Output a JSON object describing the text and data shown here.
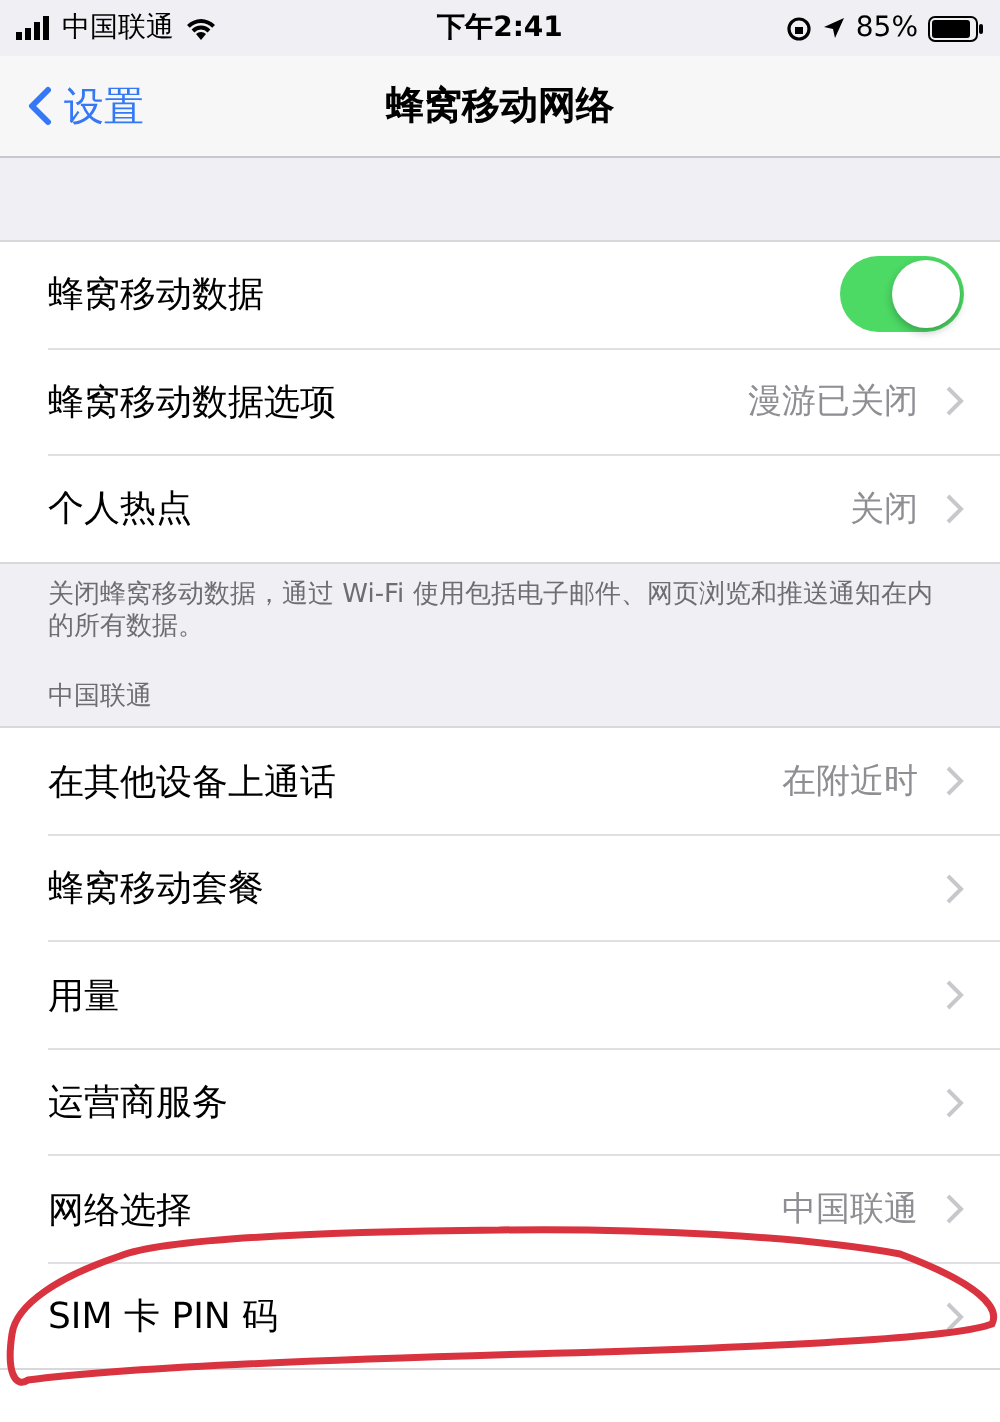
{
  "status_bar": {
    "carrier": "中国联通",
    "time": "下午2:41",
    "battery": "85%"
  },
  "nav": {
    "back": "设置",
    "title": "蜂窝移动网络"
  },
  "sections": [
    {
      "rows": [
        {
          "kind": "toggle",
          "label": "蜂窝移动数据",
          "on": true
        },
        {
          "kind": "link",
          "label": "蜂窝移动数据选项",
          "value": "漫游已关闭"
        },
        {
          "kind": "link",
          "label": "个人热点",
          "value": "关闭"
        }
      ],
      "footer": "关闭蜂窝移动数据，通过 Wi-Fi 使用包括电子邮件、网页浏览和推送通知在内的所有数据。"
    },
    {
      "header": "中国联通",
      "rows": [
        {
          "kind": "link",
          "label": "在其他设备上通话",
          "value": "在附近时"
        },
        {
          "kind": "link",
          "label": "蜂窝移动套餐"
        },
        {
          "kind": "link",
          "label": "用量"
        },
        {
          "kind": "link",
          "label": "运营商服务"
        },
        {
          "kind": "link",
          "label": "网络选择",
          "value": "中国联通"
        },
        {
          "kind": "link",
          "label": "SIM 卡 PIN 码"
        }
      ]
    }
  ]
}
